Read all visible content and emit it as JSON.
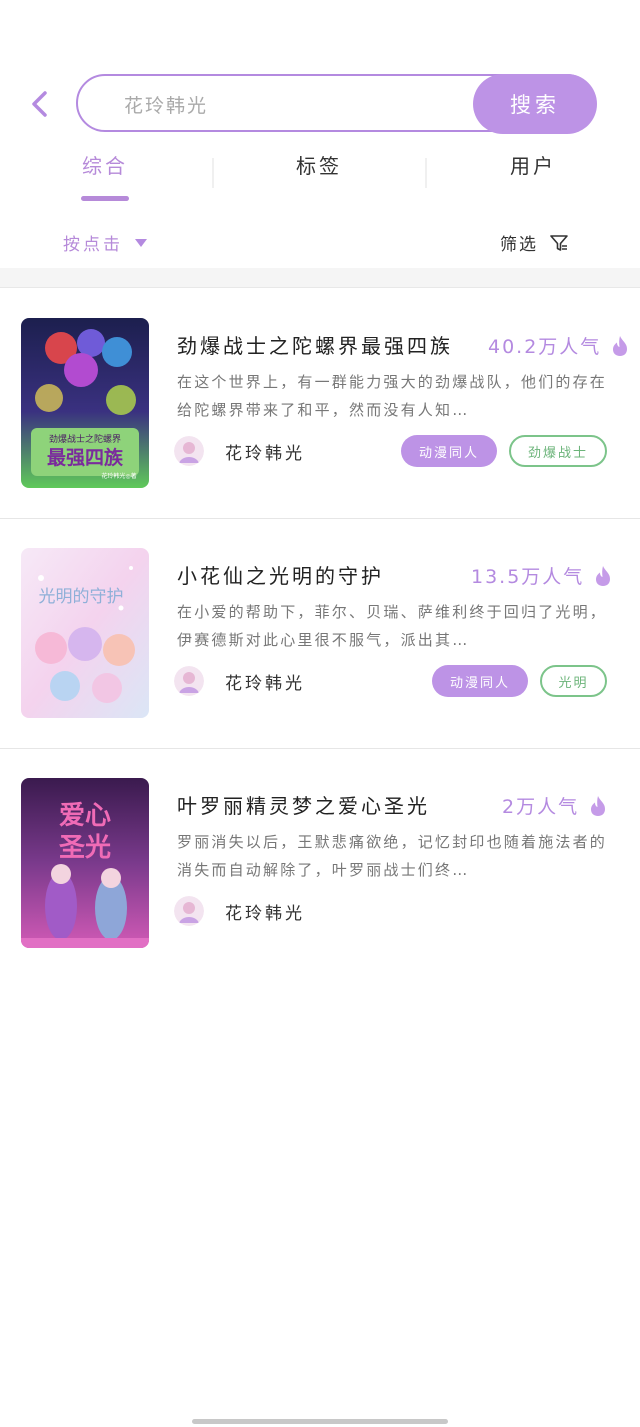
{
  "search": {
    "value": "花玲韩光",
    "button_label": "搜索"
  },
  "tabs": [
    {
      "label": "综合"
    },
    {
      "label": "标签"
    },
    {
      "label": "用户"
    }
  ],
  "filterbar": {
    "sort_label": "按点击",
    "filter_label": "筛选"
  },
  "results": [
    {
      "title": "劲爆战士之陀螺界最强四族",
      "popularity": "40.2万人气",
      "description": "在这个世界上，有一群能力强大的劲爆战队，他们的存在给陀螺界带来了和平，然而没有人知…",
      "author": "花玲韩光",
      "tags": [
        "动漫同人",
        "劲爆战士"
      ],
      "cover_lines": [
        "劲爆战士之陀螺界",
        "最强四族",
        "花玲韩光◎著"
      ]
    },
    {
      "title": "小花仙之光明的守护",
      "popularity": "13.5万人气",
      "description": "在小爱的帮助下，菲尔、贝瑞、萨维利终于回归了光明，伊赛德斯对此心里很不服气，派出其…",
      "author": "花玲韩光",
      "tags": [
        "动漫同人",
        "光明"
      ],
      "cover_lines": [
        "光明的守护"
      ]
    },
    {
      "title": "叶罗丽精灵梦之爱心圣光",
      "popularity": "2万人气",
      "description": "罗丽消失以后，王默悲痛欲绝，记忆封印也随着施法者的消失而自动解除了，叶罗丽战士们终…",
      "author": "花玲韩光",
      "tags": [],
      "cover_lines": [
        "爱心",
        "圣光"
      ]
    }
  ],
  "colors": {
    "accent": "#b48ae0",
    "accent_fill": "#bd93e6",
    "tag_green": "#7cc48a"
  }
}
